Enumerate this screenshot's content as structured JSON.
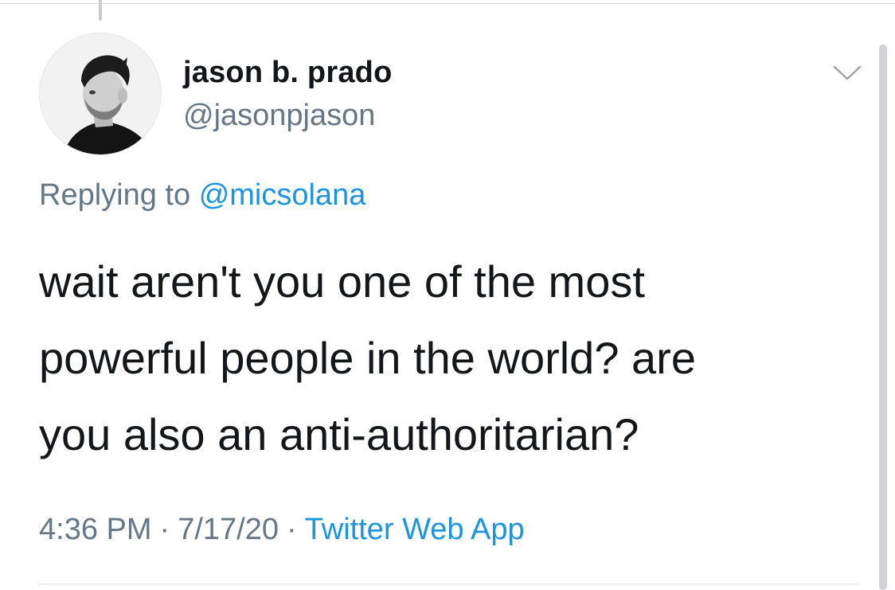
{
  "tweet": {
    "display_name": "jason b. prado",
    "handle": "@jasonpjason",
    "replying_prefix": "Replying to",
    "replying_mention": "@micsolana",
    "text_lines": [
      "wait aren't you one of the most",
      "powerful people in the world? are",
      "you also an anti-authoritarian?"
    ],
    "time": "4:36 PM",
    "date": "7/17/20",
    "separator": "·",
    "source": "Twitter Web App"
  },
  "icons": {
    "avatar": "profile-photo",
    "menu_caret": "chevron-down-icon"
  },
  "colors": {
    "text_primary": "#14171a",
    "text_secondary": "#657786",
    "link": "#1b95e0",
    "divider": "#e1e5e8"
  }
}
